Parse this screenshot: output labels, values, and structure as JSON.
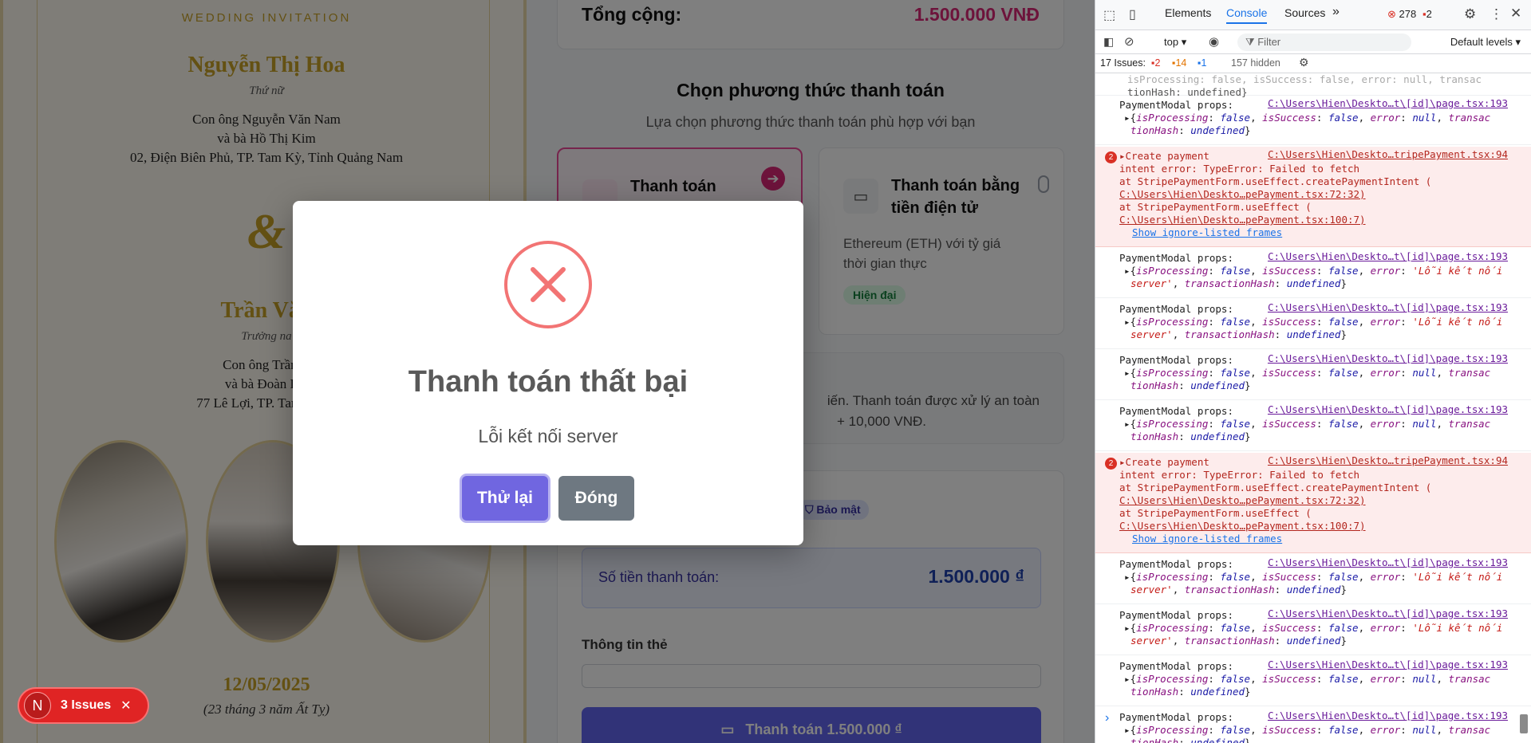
{
  "invitation": {
    "heading": "WEDDING INVITATION",
    "bride_name": "Nguyễn Thị Hoa",
    "bride_role": "Thứ nữ",
    "bride_parents_1": "Con ông Nguyễn Văn Nam",
    "bride_parents_2": "và bà Hồ Thị Kim",
    "bride_address": "02, Điện Biên Phủ, TP. Tam Kỳ, Tỉnh Quảng Nam",
    "ampersand": "&",
    "groom_name": "Trần Văn",
    "groom_role": "Trưởng na",
    "groom_parents_1": "Con ông Trần V",
    "groom_parents_2": "và bà Đoàn Kir",
    "groom_address": "77 Lê Lợi, TP. Tam Kỳ, T",
    "date": "12/05/2025",
    "lunar_date": "(23 tháng 3 năm Ất Tỵ)"
  },
  "payment": {
    "total_label": "Tổng cộng:",
    "total_value": "1.500.000 VNĐ",
    "method_title": "Chọn phương thức thanh toán",
    "method_subtitle": "Lựa chọn phương thức thanh toán phù hợp với bạn",
    "card_option_title": "Thanh toán",
    "card_option_title_2": "t",
    "crypto_option_title_1": "Thanh toán bằng",
    "crypto_option_title_2": "tiền điện tử",
    "crypto_option_desc_1": "Ethereum (ETH) với tỷ giá",
    "crypto_option_desc_2": "thời gian thực",
    "crypto_option_badge": "Hiện đại",
    "info_line_1": "iến. Thanh toán được xử lý an toàn",
    "info_line_2": "+ 10,000 VNĐ.",
    "security_badge": "Bảo mật",
    "amount_label": "Số tiền thanh toán:",
    "amount_value": "1.500.000 ₫",
    "card_info_label": "Thông tin thẻ",
    "submit_label": "Thanh toán 1.500.000 ₫"
  },
  "modal": {
    "title": "Thanh toán thất bại",
    "message": "Lỗi kết nối server",
    "retry_label": "Thử lại",
    "close_label": "Đóng"
  },
  "issues_toast": {
    "avatar_letter": "N",
    "label": "3 Issues",
    "close_glyph": "✕"
  },
  "devtools": {
    "tabs": [
      "Elements",
      "Console",
      "Sources"
    ],
    "more_tabs": "»",
    "error_count": "278",
    "warning_count": "2",
    "context": "top",
    "filter_placeholder": "Filter",
    "levels": "Default levels",
    "issues_label": "17 Issues:",
    "issues_err": "2",
    "issues_warn": "14",
    "issues_info": "1",
    "hidden": "157 hidden",
    "top_fragment_1": "isProcessing: false, isSuccess: false, error: null, transac",
    "top_fragment_2": "tionHash: undefined}",
    "logs": [
      {
        "kind": "log",
        "label": "PaymentModal props:",
        "src": "C:\\Users\\Hien\\Deskto…t\\[id]\\page.tsx:193",
        "l2": "{isProcessing: false, isSuccess: false, error: null, transac",
        "l3": "tionHash: undefined}"
      },
      {
        "kind": "err",
        "count": "2",
        "label": "▸Create payment",
        "src": "C:\\Users\\Hien\\Deskto…tripePayment.tsx:94",
        "l2": "intent error: TypeError: Failed to fetch",
        "l3": "    at StripePaymentForm.useEffect.createPaymentIntent (",
        "l4": "C:\\Users\\Hien\\Deskto…pePayment.tsx:72:32)",
        "l5": "    at StripePaymentForm.useEffect (",
        "l6": "C:\\Users\\Hien\\Deskto…pePayment.tsx:100:7)",
        "l7": "Show ignore-listed frames"
      },
      {
        "kind": "log",
        "label": "PaymentModal props:",
        "src": "C:\\Users\\Hien\\Deskto…t\\[id]\\page.tsx:193",
        "l2": "{isProcessing: false, isSuccess: false, error: 'Lỗi kết nối",
        "l3": "server', transactionHash: undefined}"
      },
      {
        "kind": "log",
        "label": "PaymentModal props:",
        "src": "C:\\Users\\Hien\\Deskto…t\\[id]\\page.tsx:193",
        "l2": "{isProcessing: false, isSuccess: false, error: 'Lỗi kết nối",
        "l3": "server', transactionHash: undefined}"
      },
      {
        "kind": "log",
        "label": "PaymentModal props:",
        "src": "C:\\Users\\Hien\\Deskto…t\\[id]\\page.tsx:193",
        "l2": "{isProcessing: false, isSuccess: false, error: null, transac",
        "l3": "tionHash: undefined}"
      },
      {
        "kind": "log",
        "label": "PaymentModal props:",
        "src": "C:\\Users\\Hien\\Deskto…t\\[id]\\page.tsx:193",
        "l2": "{isProcessing: false, isSuccess: false, error: null, transac",
        "l3": "tionHash: undefined}"
      },
      {
        "kind": "err",
        "count": "2",
        "label": "▸Create payment",
        "src": "C:\\Users\\Hien\\Deskto…tripePayment.tsx:94",
        "l2": "intent error: TypeError: Failed to fetch",
        "l3": "    at StripePaymentForm.useEffect.createPaymentIntent (",
        "l4": "C:\\Users\\Hien\\Deskto…pePayment.tsx:72:32)",
        "l5": "    at StripePaymentForm.useEffect (",
        "l6": "C:\\Users\\Hien\\Deskto…pePayment.tsx:100:7)",
        "l7": "Show ignore-listed frames"
      },
      {
        "kind": "log",
        "label": "PaymentModal props:",
        "src": "C:\\Users\\Hien\\Deskto…t\\[id]\\page.tsx:193",
        "l2": "{isProcessing: false, isSuccess: false, error: 'Lỗi kết nối",
        "l3": "server', transactionHash: undefined}"
      },
      {
        "kind": "log",
        "label": "PaymentModal props:",
        "src": "C:\\Users\\Hien\\Deskto…t\\[id]\\page.tsx:193",
        "l2": "{isProcessing: false, isSuccess: false, error: 'Lỗi kết nối",
        "l3": "server', transactionHash: undefined}"
      },
      {
        "kind": "log",
        "label": "PaymentModal props:",
        "src": "C:\\Users\\Hien\\Deskto…t\\[id]\\page.tsx:193",
        "l2": "{isProcessing: false, isSuccess: false, error: null, transac",
        "l3": "tionHash: undefined}"
      },
      {
        "kind": "log",
        "label": "PaymentModal props:",
        "src": "C:\\Users\\Hien\\Deskto…t\\[id]\\page.tsx:193",
        "l2": "{isProcessing: false, isSuccess: false, error: null, transac",
        "l3": "tionHash: undefined}"
      }
    ],
    "prompt": "›"
  }
}
